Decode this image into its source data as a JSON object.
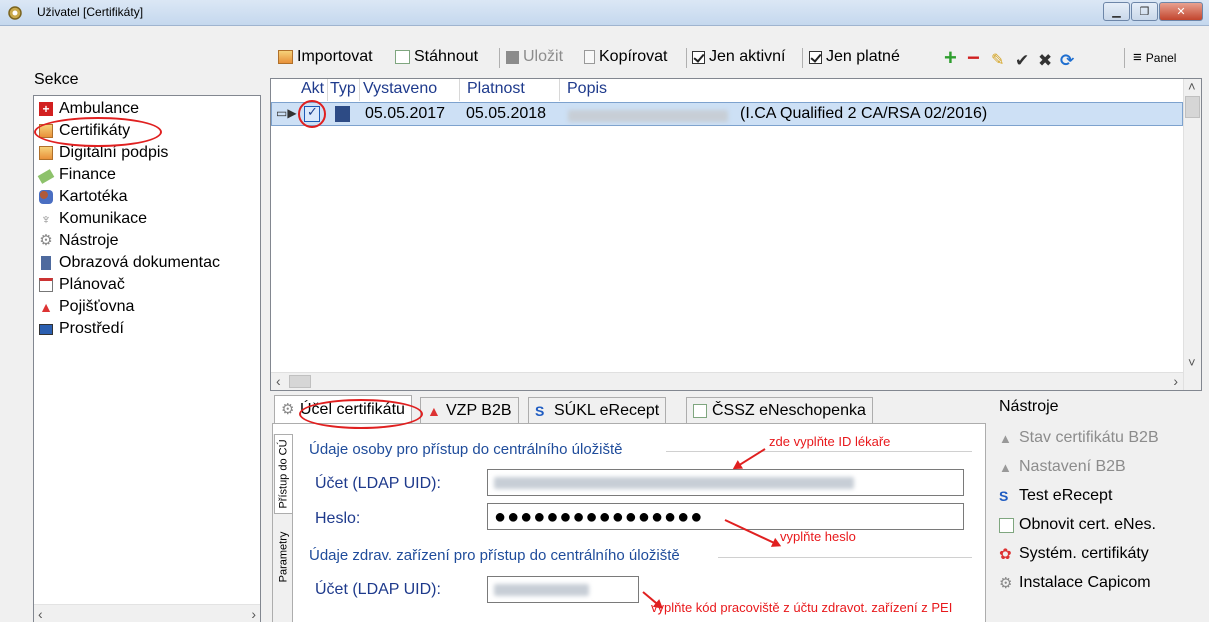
{
  "window": {
    "title": "Uživatel [Certifikáty]",
    "icon": "gear-app-icon"
  },
  "sidebar": {
    "label": "Sekce",
    "items": [
      {
        "label": "Ambulance",
        "icon": "ambulance-icon"
      },
      {
        "label": "Certifikáty",
        "icon": "certificate-icon"
      },
      {
        "label": "Digitální podpis",
        "icon": "signature-icon"
      },
      {
        "label": "Finance",
        "icon": "money-icon"
      },
      {
        "label": "Kartotéka",
        "icon": "people-icon"
      },
      {
        "label": "Komunikace",
        "icon": "antenna-icon"
      },
      {
        "label": "Nástroje",
        "icon": "gear-icon"
      },
      {
        "label": "Obrazová dokumentac",
        "icon": "film-icon"
      },
      {
        "label": "Plánovač",
        "icon": "calendar-icon"
      },
      {
        "label": "Pojišťovna",
        "icon": "insurance-icon"
      },
      {
        "label": "Prostředí",
        "icon": "monitor-icon"
      }
    ]
  },
  "toolbar": {
    "import": "Importovat",
    "download": "Stáhnout",
    "save": "Uložit",
    "copy": "Kopírovat",
    "only_active": "Jen aktivní",
    "only_valid": "Jen platné",
    "panel": "Panel"
  },
  "grid": {
    "columns": [
      "Akt",
      "Typ",
      "Vystaveno",
      "Platnost",
      "Popis"
    ],
    "rows": [
      {
        "akt": true,
        "vystaveno": "05.05.2017",
        "platnost": "05.05.2018",
        "popis": "(I.CA Qualified 2 CA/RSA 02/2016)"
      }
    ]
  },
  "tabs": [
    {
      "label": "Účel certifikátu",
      "icon": "gear-icon"
    },
    {
      "label": "VZP B2B",
      "icon": "vzp-icon"
    },
    {
      "label": "SÚKL eRecept",
      "icon": "sukl-icon"
    },
    {
      "label": "ČSSZ eNeschopenka",
      "icon": "cssz-icon"
    }
  ],
  "vertical_tabs": [
    "Přístup do CÚ",
    "Parametry"
  ],
  "form": {
    "section1": "Údaje osoby pro přístup do centrálního úložiště",
    "account_label": "Účet (LDAP UID):",
    "password_label": "Heslo:",
    "password_value": "●●●●●●●●●●●●●●●●",
    "section2": "Údaje zdrav. zařízení pro přístup do centrálního úložiště",
    "account2_label": "Účet (LDAP UID):"
  },
  "annotations": {
    "note1": "zde vyplňte ID lékaře",
    "note2": "vyplňte heslo",
    "note3": "vyplňte kód pracoviště z účtu zdravot. zařízení z PEI"
  },
  "tools": {
    "label": "Nástroje",
    "items": [
      {
        "label": "Stav certifikátu B2B",
        "icon": "vzp-icon",
        "enabled": false
      },
      {
        "label": "Nastavení B2B",
        "icon": "vzp-icon",
        "enabled": false
      },
      {
        "label": "Test eRecept",
        "icon": "sukl-icon",
        "enabled": true
      },
      {
        "label": "Obnovit cert. eNes.",
        "icon": "cssz-icon",
        "enabled": true
      },
      {
        "label": "Systém. certifikáty",
        "icon": "ribbon-icon",
        "enabled": true
      },
      {
        "label": "Instalace Capicom",
        "icon": "gear-icon",
        "enabled": true
      }
    ]
  },
  "colors": {
    "accent": "#1f4c9b",
    "annotation": "#e02020",
    "selection": "#cde0f5"
  }
}
